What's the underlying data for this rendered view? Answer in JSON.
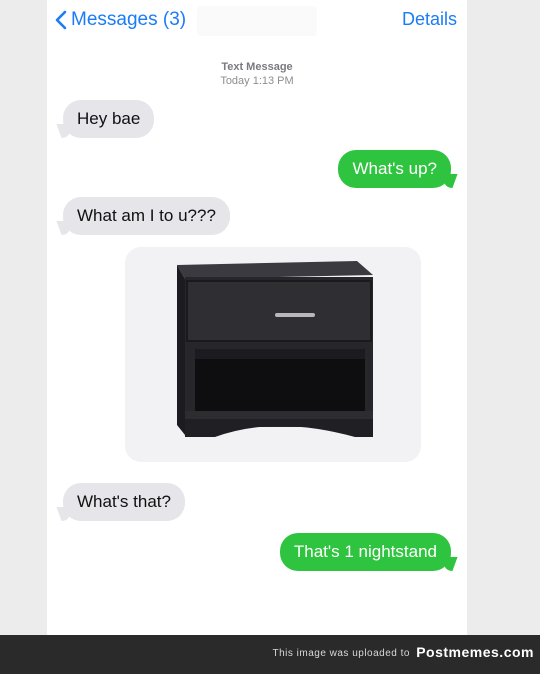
{
  "nav": {
    "back_label": "Messages (3)",
    "details_label": "Details"
  },
  "thread": {
    "type_label": "Text Message",
    "time_label": "Today 1:13 PM"
  },
  "messages": [
    {
      "direction": "incoming",
      "text": "Hey bae"
    },
    {
      "direction": "outgoing",
      "text": "What's up?"
    },
    {
      "direction": "incoming",
      "text": "What am I to u???"
    },
    {
      "direction": "incoming",
      "type": "image",
      "content": "nightstand"
    },
    {
      "direction": "incoming",
      "text": "What's that?"
    },
    {
      "direction": "outgoing",
      "text": "That's 1 nightstand"
    }
  ],
  "footer": {
    "text": "This image was uploaded to",
    "brand": "Postmemes.com"
  },
  "colors": {
    "ios_blue": "#1a7cf6",
    "outgoing_bubble": "#2fc43f",
    "incoming_bubble": "#e5e5ea"
  },
  "icons": {
    "back": "chevron-left-icon"
  }
}
